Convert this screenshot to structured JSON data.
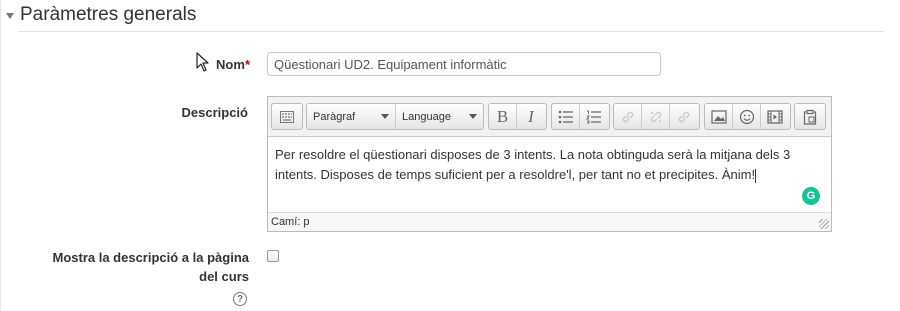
{
  "section": {
    "title": "Paràmetres generals"
  },
  "name_field": {
    "label": "Nom",
    "required_marker": "*",
    "value": "Qüestionari UD2. Equipament informàtic"
  },
  "description_field": {
    "label": "Descripció"
  },
  "editor": {
    "toolbar": {
      "format_select": "Paràgraf",
      "language_select": "Language",
      "buttons": [
        "toolbar-toggle",
        "bold",
        "italic",
        "unordered-list",
        "ordered-list",
        "link",
        "unlink",
        "anchor",
        "image",
        "emoticon",
        "media",
        "paste"
      ]
    },
    "content": "Per resoldre el qüestionari disposes de 3 intents. La nota obtinguda serà la mitjana dels 3 intents. Disposes de temps suficient per a resoldre'l, per tant no et precipites. Ànim!",
    "path": "Camí: p",
    "grammarly_letter": "G"
  },
  "show_description": {
    "label_line1": "Mostra la descripció a la pàgina",
    "label_line2": "del curs",
    "checked": false,
    "help_glyph": "?"
  },
  "colors": {
    "required": "#cc0000",
    "grammarly": "#15c39a"
  }
}
